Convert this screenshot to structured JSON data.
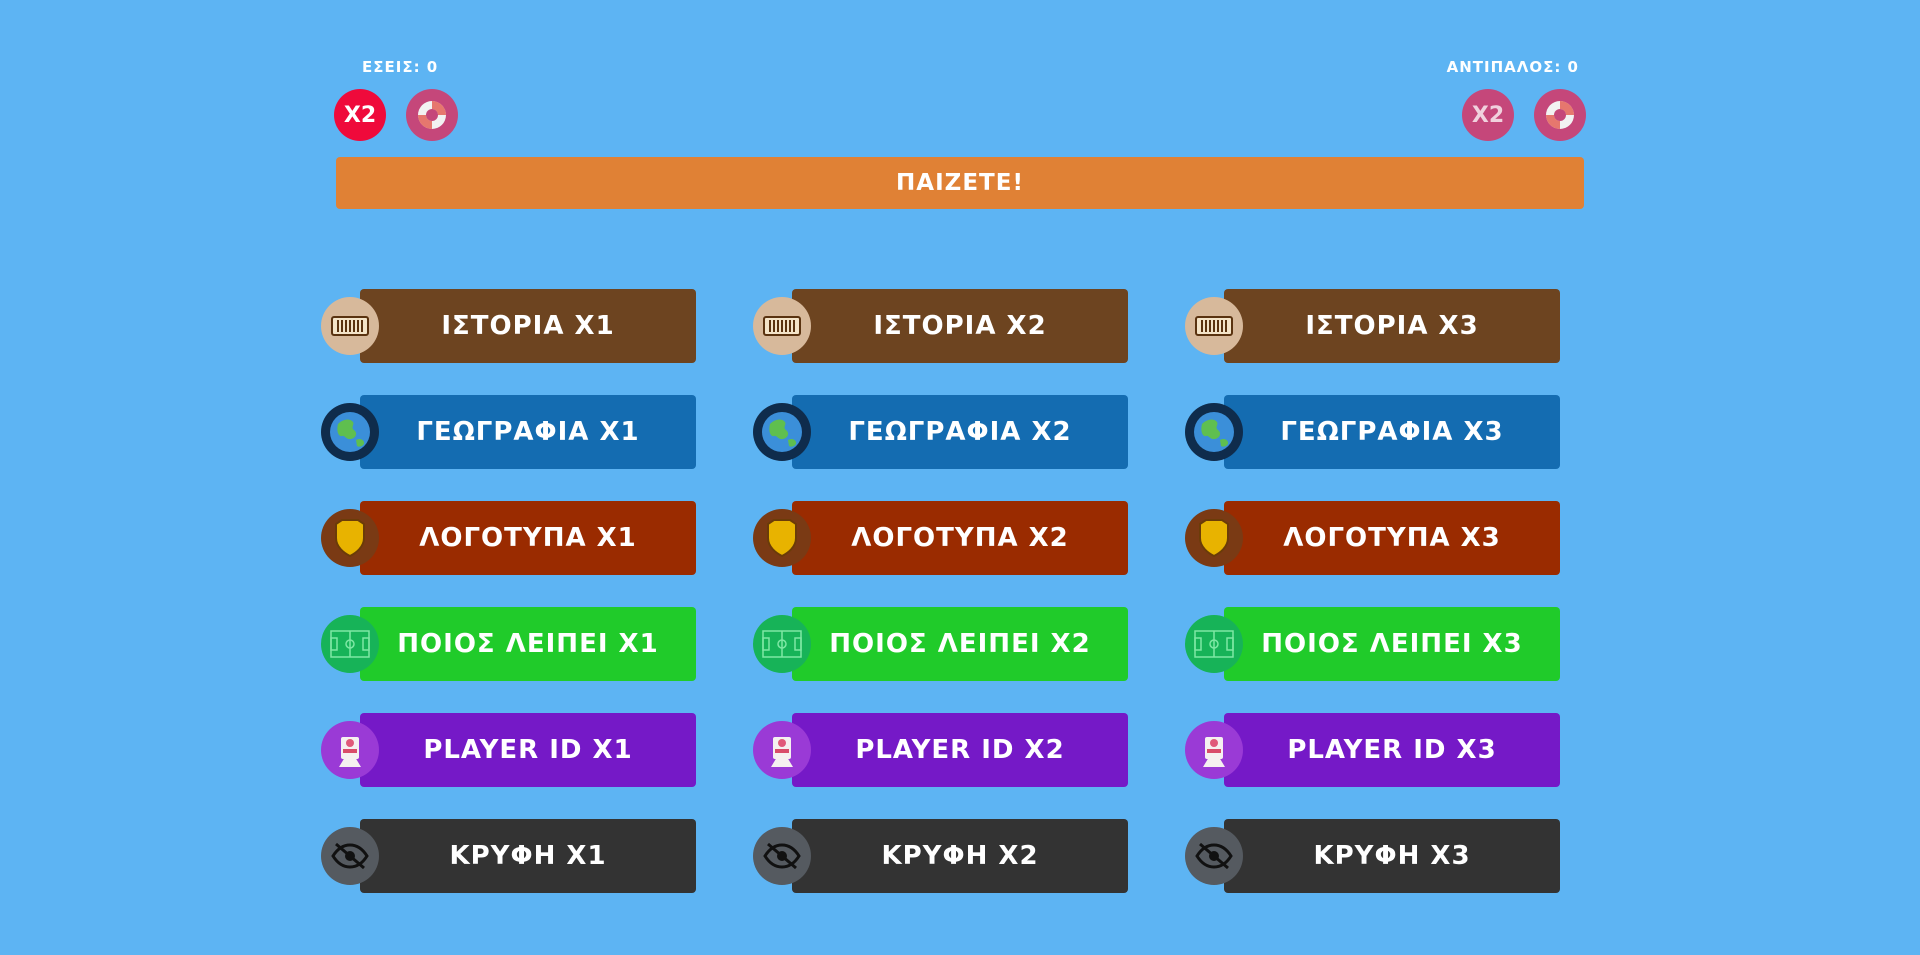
{
  "header": {
    "you_score": "ΕΣΕΙΣ: 0",
    "opponent_score": "ΑΝΤΙΠΑΛΟΣ: 0",
    "x2_label": "X2",
    "status": "ΠΑΙΖΕΤΕ!"
  },
  "categories": {
    "history": [
      "ΙΣΤΟΡΙΑ X1",
      "ΙΣΤΟΡΙΑ X2",
      "ΙΣΤΟΡΙΑ X3"
    ],
    "geography": [
      "ΓΕΩΓΡΑΦΙΑ X1",
      "ΓΕΩΓΡΑΦΙΑ X2",
      "ΓΕΩΓΡΑΦΙΑ X3"
    ],
    "logos": [
      "ΛΟΓΟΤΥΠΑ X1",
      "ΛΟΓΟΤΥΠΑ X2",
      "ΛΟΓΟΤΥΠΑ X3"
    ],
    "who_missing": [
      "ΠΟΙΟΣ ΛΕΙΠΕΙ X1",
      "ΠΟΙΟΣ ΛΕΙΠΕΙ X2",
      "ΠΟΙΟΣ ΛΕΙΠΕΙ X3"
    ],
    "player_id": [
      "PLAYER ID X1",
      "PLAYER ID X2",
      "PLAYER ID X3"
    ],
    "hidden": [
      "ΚΡΥΦΗ X1",
      "ΚΡΥΦΗ X2",
      "ΚΡΥΦΗ X3"
    ]
  },
  "icons": {
    "history": "scroll-icon",
    "geography": "globe-icon",
    "logos": "shield-icon",
    "who_missing": "pitch-icon",
    "player_id": "player-card-icon",
    "hidden": "eye-slash-icon",
    "lifeline": "lifebuoy-icon"
  },
  "colors": {
    "background": "#5db4f3",
    "status_bar": "#e08135",
    "history": "#6d4420",
    "geography": "#146cb1",
    "logos": "#9a2b00",
    "who_missing": "#20cb2a",
    "player_id": "#7519c7",
    "hidden": "#333333"
  }
}
